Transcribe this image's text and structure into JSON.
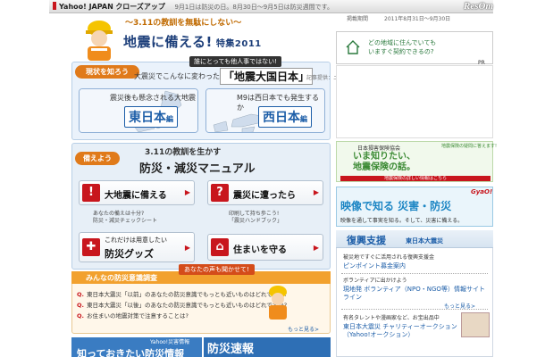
{
  "topbar": {
    "brand": "Yahoo! JAPAN",
    "brand_sub": "クローズアップ",
    "notice": "9月1日は防災の日。8月30日～9月5日は防災週間です。",
    "logo": "ResOm"
  },
  "header": {
    "subtitle": "～3.11の教訓を無駄にしない～",
    "title": "地震に備える!",
    "feature": "特集2011",
    "period_label": "掲載期間",
    "period": "2011年8月31日～9月30日"
  },
  "section_know": {
    "badge": "現状を知ろう",
    "caption": "誰にとっても他人事ではない!",
    "lead": "大震災でこんなに変わった",
    "title": "「地震大国日本」",
    "note": "記事提供：ニュートン",
    "east": {
      "caption": "震災後も懸念される大地震",
      "region": "東日本",
      "suffix": "編"
    },
    "west": {
      "caption": "M9は西日本でも発生するか",
      "region": "西日本",
      "suffix": "編"
    }
  },
  "section_prepare": {
    "badge": "備えよう",
    "sub": "3.11の教訓を生かす",
    "title": "防災・減災マニュアル",
    "tiles": [
      {
        "icon": "!",
        "label": "大地震に備える"
      },
      {
        "icon": "?",
        "label": "震災に遭ったら"
      },
      {
        "icon": "✚",
        "label": "これだけは用意したい",
        "label2": "防災グッズ"
      },
      {
        "icon": "⌂",
        "label": "住まいを守る"
      }
    ],
    "sub_items": [
      {
        "q": "あなたの備えは十分?",
        "link": "防災・減災チェックシート"
      },
      {
        "q": "印刷して持ち歩こう!",
        "link": "「震災ハンドブック」"
      }
    ]
  },
  "section_survey": {
    "tag": "あなたの声も聞かせて!",
    "title": "みんなの防災意識調査",
    "questions": [
      "東日本大震災「以前」のあなたの防災意識でもっとも近いものはどれですか?",
      "東日本大震災「以後」のあなたの防災意識でもっとも近いものはどれですか?",
      "お住まいの地震対策で注意することは?"
    ],
    "more": "もっと見る>"
  },
  "bottom": {
    "left_caption": "Yahoo!災害情報",
    "left_title": "知っておきたい防災情報",
    "mid_title": "防災速報"
  },
  "right": {
    "pr": "PR",
    "ad1_line1": "どの地域に住んでいても",
    "ad1_line2": "いますぐ契約できるの?",
    "ad2_head": "日本損害保険協会",
    "ad2_title1": "いま知りたい、",
    "ad2_title2": "地震保険の話。",
    "ad2_side": "地震保険の疑問に答えます!",
    "ad2_foot": "地震保険の詳しい情報はこちら",
    "ad3_title": "映像で知る 災害・防災",
    "ad3_gyao": "GyaO!",
    "ad3_sub": "映像を通して事実を知る。そして、災害に備える。",
    "fukko_title": "復興支援",
    "fukko_sub": "東日本大震災",
    "fukko_items": [
      {
        "text": "被災地ですぐに活用される復興支援金",
        "link": "ピンポイント募金案内"
      },
      {
        "text": "ボランティアに出かけよう",
        "link": "現地発 ボランティア（NPO・NGO等）情報サイトライン"
      },
      {
        "text": "有名タレントや漫画家など、お宝出品中",
        "link": "東日本大震災 チャリティーオークション（Yahoo!オークション）"
      }
    ],
    "fukko_more": "もっと見る>"
  }
}
